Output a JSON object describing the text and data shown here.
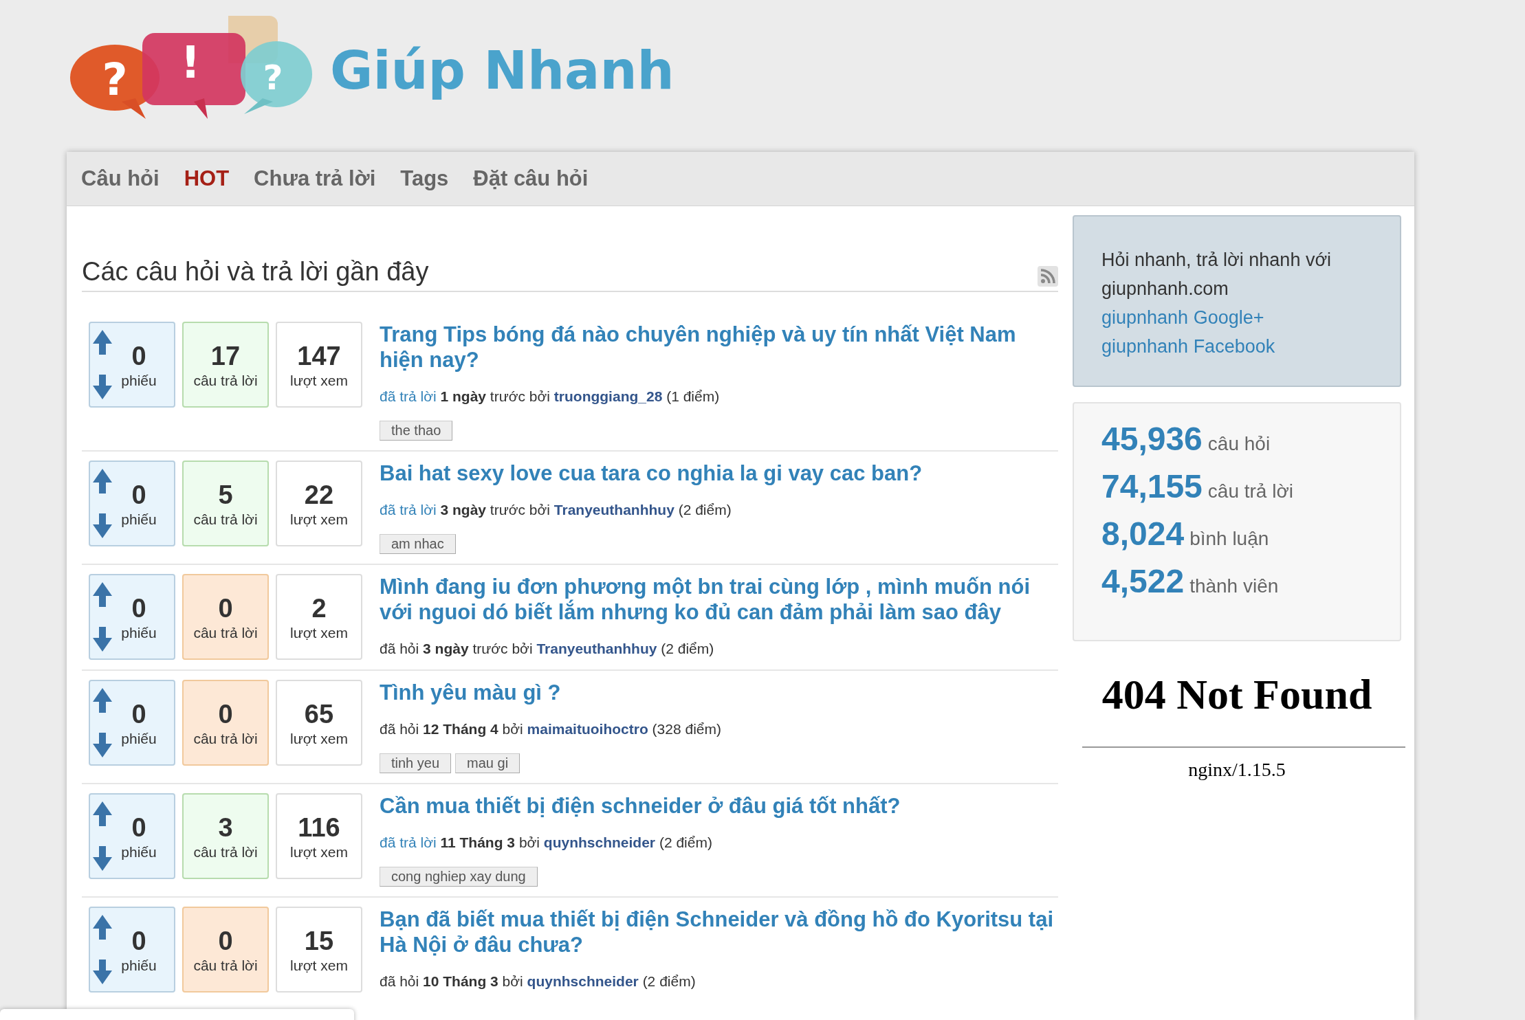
{
  "logo": {
    "marks": [
      "?",
      "!",
      "?"
    ],
    "name": "Giúp Nhanh"
  },
  "nav": [
    {
      "label": "Câu hỏi",
      "selected": false
    },
    {
      "label": "HOT",
      "selected": true
    },
    {
      "label": "Chưa trả lời",
      "selected": false
    },
    {
      "label": "Tags",
      "selected": false
    },
    {
      "label": "Đặt câu hỏi",
      "selected": false
    }
  ],
  "heading": "Các câu hỏi và trả lời gần đây",
  "questions": [
    {
      "votes": "0",
      "votes_label": "phiếu",
      "answers": "17",
      "answers_label": "câu trả lời",
      "answered": true,
      "views": "147",
      "views_label": "lượt xem",
      "title": "Trang Tips bóng đá nào chuyên nghiệp và uy tín nhất Việt Nam hiện nay?",
      "meta": {
        "kind": "answered",
        "action": "đã trả lời",
        "when": "1 ngày",
        "by": "trước bởi",
        "user": "truonggiang_28",
        "points": "(1 điểm)"
      },
      "tags": [
        "the thao"
      ]
    },
    {
      "votes": "0",
      "votes_label": "phiếu",
      "answers": "5",
      "answers_label": "câu trả lời",
      "answered": true,
      "views": "22",
      "views_label": "lượt xem",
      "title": "Bai hat sexy love cua tara co nghia la gi vay cac ban?",
      "meta": {
        "kind": "answered",
        "action": "đã trả lời",
        "when": "3 ngày",
        "by": "trước bởi",
        "user": "Tranyeuthanhhuy",
        "points": "(2 điểm)"
      },
      "tags": [
        "am nhac"
      ]
    },
    {
      "votes": "0",
      "votes_label": "phiếu",
      "answers": "0",
      "answers_label": "câu trả lời",
      "answered": false,
      "views": "2",
      "views_label": "lượt xem",
      "title": "Mình đang iu đơn phương một bn trai cùng lớp , mình muốn nói với nguoi dó biết lắm nhưng ko đủ can đảm phải làm sao đây",
      "meta": {
        "kind": "asked",
        "action": "đã hỏi",
        "when": "3 ngày",
        "by": "trước bởi",
        "user": "Tranyeuthanhhuy",
        "points": "(2 điểm)"
      }
    },
    {
      "votes": "0",
      "votes_label": "phiếu",
      "answers": "0",
      "answers_label": "câu trả lời",
      "answered": false,
      "views": "65",
      "views_label": "lượt xem",
      "title": "Tình yêu màu gì ?",
      "meta": {
        "kind": "asked",
        "action": "đã hỏi",
        "when": "12 Tháng 4",
        "by": "bởi",
        "user": "maimaituoihoctro",
        "points": "(328 điểm)"
      },
      "tags": [
        "tinh yeu",
        "mau gi"
      ]
    },
    {
      "votes": "0",
      "votes_label": "phiếu",
      "answers": "3",
      "answers_label": "câu trả lời",
      "answered": true,
      "views": "116",
      "views_label": "lượt xem",
      "title": "Cần mua thiết bị điện schneider ở đâu giá tốt nhất?",
      "meta": {
        "kind": "answered",
        "action": "đã trả lời",
        "when": "11 Tháng 3",
        "by": "bởi",
        "user": "quynhschneider",
        "points": "(2 điểm)"
      },
      "tags": [
        "cong nghiep xay dung"
      ]
    },
    {
      "votes": "0",
      "votes_label": "phiếu",
      "answers": "0",
      "answers_label": "câu trả lời",
      "answered": false,
      "views": "15",
      "views_label": "lượt xem",
      "title": "Bạn đã biết mua thiết bị điện Schneider và đồng hồ đo Kyoritsu tại Hà Nội ở đâu chưa?",
      "meta": {
        "kind": "asked",
        "action": "đã hỏi",
        "when": "10 Tháng 3",
        "by": "bởi",
        "user": "quynhschneider",
        "points": "(2 điểm)"
      }
    }
  ],
  "sidebar": {
    "intro": [
      "Hỏi nhanh, trả lời nhanh với",
      "giupnhanh.com"
    ],
    "links": [
      "giupnhanh Google+",
      "giupnhanh Facebook"
    ],
    "stats": [
      {
        "value": "45,936",
        "label": "câu hỏi"
      },
      {
        "value": "74,155",
        "label": "câu trả lời"
      },
      {
        "value": "8,024",
        "label": "bình luận"
      },
      {
        "value": "4,522",
        "label": "thành viên"
      }
    ],
    "error": {
      "title": "404 Not Found",
      "server": "nginx/1.15.5"
    }
  }
}
